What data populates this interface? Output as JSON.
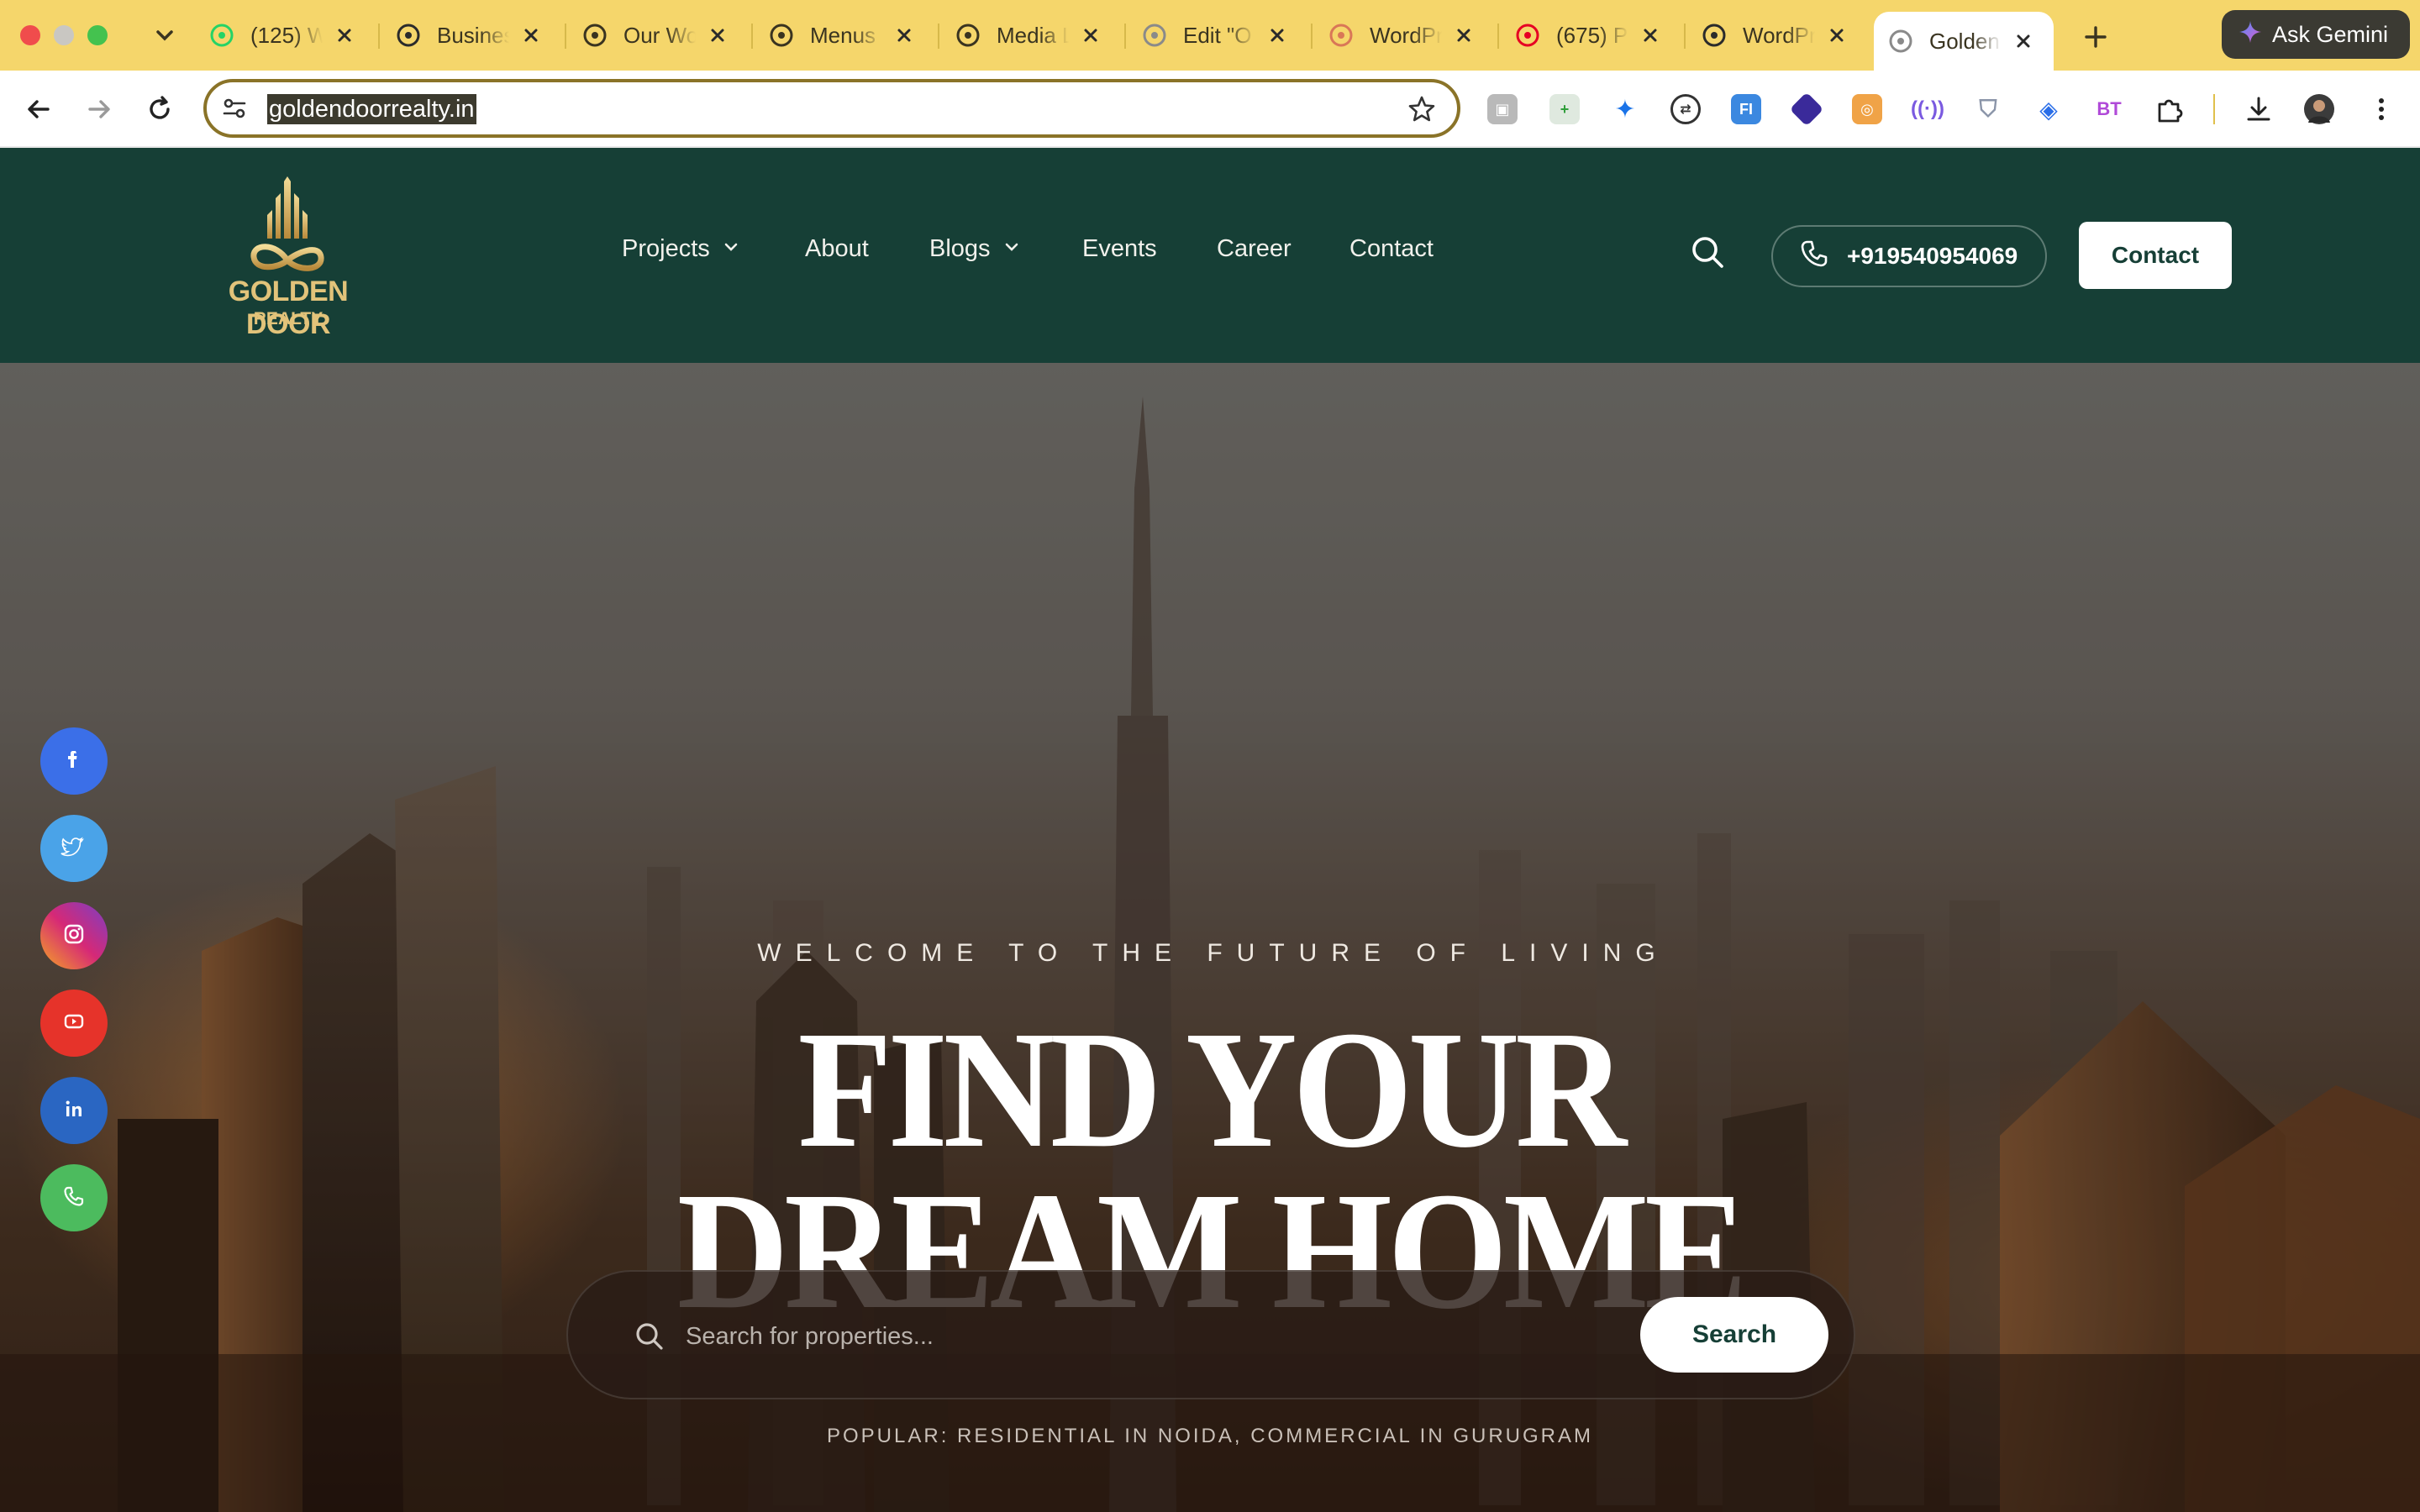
{
  "browser": {
    "tabs": [
      {
        "title": "(125) W",
        "icon": "whatsapp-icon",
        "color": "#25d366"
      },
      {
        "title": "Business",
        "icon": "openai-icon",
        "color": "#2b2b2b"
      },
      {
        "title": "Our Work",
        "icon": "wordpress-icon",
        "color": "#3a3420"
      },
      {
        "title": "Menus",
        "icon": "wordpress-icon",
        "color": "#3a3420"
      },
      {
        "title": "Media Library",
        "icon": "wordpress-icon",
        "color": "#3a3420"
      },
      {
        "title": "Edit \"O",
        "icon": "globe-icon",
        "color": "#8a8a8a"
      },
      {
        "title": "WordPress",
        "icon": "claude-icon",
        "color": "#d97757"
      },
      {
        "title": "(675) P",
        "icon": "pinterest-icon",
        "color": "#e60023"
      },
      {
        "title": "WordPress",
        "icon": "openai-icon",
        "color": "#2b2b2b"
      },
      {
        "title": "Golden",
        "icon": "globe-icon",
        "color": "#8a8a8a"
      }
    ],
    "gemini_label": "Ask Gemini",
    "url": "goldendoorrealty.in"
  },
  "header": {
    "logo_text": "GOLDEN DOOR",
    "logo_sub": "REALTY",
    "menu": [
      {
        "label": "Projects",
        "dropdown": true
      },
      {
        "label": "About",
        "dropdown": false
      },
      {
        "label": "Blogs",
        "dropdown": true
      },
      {
        "label": "Events",
        "dropdown": false
      },
      {
        "label": "Career",
        "dropdown": false
      },
      {
        "label": "Contact",
        "dropdown": false
      }
    ],
    "phone": "+919540954069",
    "contact_label": "Contact"
  },
  "social": [
    {
      "name": "facebook-icon",
      "color": "#3b6fe8"
    },
    {
      "name": "twitter-icon",
      "color": "#4aa3e8"
    },
    {
      "name": "instagram-icon",
      "color": "#c1358f"
    },
    {
      "name": "youtube-icon",
      "color": "#e6332a"
    },
    {
      "name": "linkedin-icon",
      "color": "#2a66c2"
    },
    {
      "name": "phone-icon",
      "color": "#4cbb5e"
    }
  ],
  "hero": {
    "eyebrow": "WELCOME TO THE FUTURE OF LIVING",
    "headline_line1": "FIND YOUR",
    "headline_line2": "DREAM HOME",
    "search_placeholder": "Search for properties...",
    "search_button": "Search",
    "popular": "POPULAR: RESIDENTIAL IN NOIDA, COMMERCIAL IN GURUGRAM"
  },
  "colors": {
    "brand_green": "#163f36",
    "brand_gold": "#e2c37a",
    "chrome_yellow": "#f5d66b"
  }
}
